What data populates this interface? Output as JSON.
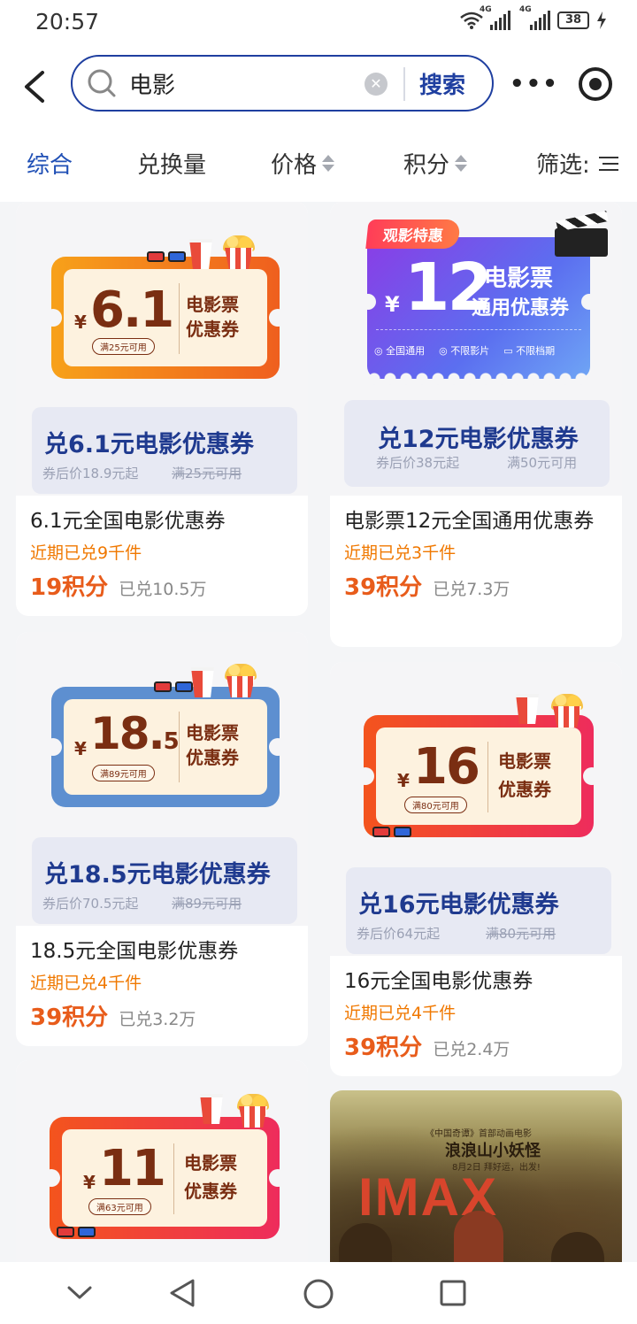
{
  "status_bar": {
    "time": "20:57",
    "network_1": "4G",
    "network_2": "4G",
    "battery": "38"
  },
  "search": {
    "value": "电影",
    "button": "搜索"
  },
  "sort_tabs": [
    {
      "label": "综合",
      "active": true
    },
    {
      "label": "兑换量"
    },
    {
      "label": "价格"
    },
    {
      "label": "积分"
    },
    {
      "label": "筛选:"
    }
  ],
  "cards": [
    {
      "coupon_amount": "6.1",
      "coupon_condition": "满25元可用",
      "coupon_label_1": "电影票",
      "coupon_label_2": "优惠券",
      "sub_title": "兑6.1元电影优惠券",
      "sub_after": "券后价18.9元起",
      "sub_min": "满25元可用",
      "title": "6.1元全国电影优惠券",
      "recent": "近期已兑9千件",
      "points": "19积分",
      "sold": "已兑10.5万"
    },
    {
      "badge": "观影特惠",
      "coupon_amount": "12",
      "coupon_label_1": "电影票",
      "coupon_label_2": "通用优惠券",
      "features": [
        "全国通用",
        "不限影片",
        "不限档期"
      ],
      "sub_title": "兑12元电影优惠券",
      "sub_after": "券后价38元起",
      "sub_min": "满50元可用",
      "title": "电影票12元全国通用优惠券",
      "recent": "近期已兑3千件",
      "points": "39积分",
      "sold": "已兑7.3万"
    },
    {
      "coupon_amount": "18.",
      "coupon_amount_small": "5",
      "coupon_condition": "满89元可用",
      "coupon_label_1": "电影票",
      "coupon_label_2": "优惠券",
      "sub_title": "兑18.5元电影优惠券",
      "sub_after": "券后价70.5元起",
      "sub_min": "满89元可用",
      "title": "18.5元全国电影优惠券",
      "recent": "近期已兑4千件",
      "points": "39积分",
      "sold": "已兑3.2万"
    },
    {
      "coupon_amount": "16",
      "coupon_condition": "满80元可用",
      "coupon_label_1": "电影票",
      "coupon_label_2": "优惠券",
      "sub_title": "兑16元电影优惠券",
      "sub_after": "券后价64元起",
      "sub_min": "满80元可用",
      "title": "16元全国电影优惠券",
      "recent": "近期已兑4千件",
      "points": "39积分",
      "sold": "已兑2.4万"
    },
    {
      "coupon_amount": "11",
      "coupon_condition": "满63元可用",
      "coupon_label_1": "电影票",
      "coupon_label_2": "优惠券"
    },
    {
      "poster_kicker": "《中国奇谭》首部动画电影",
      "poster_title": "浪浪山小妖怪",
      "poster_date": "8月2日 拜好运，出发!",
      "poster_brand": "IMAX"
    }
  ],
  "colors": {
    "accent": "#1f3fa0",
    "points": "#e85c1b",
    "recent": "#f07800"
  }
}
